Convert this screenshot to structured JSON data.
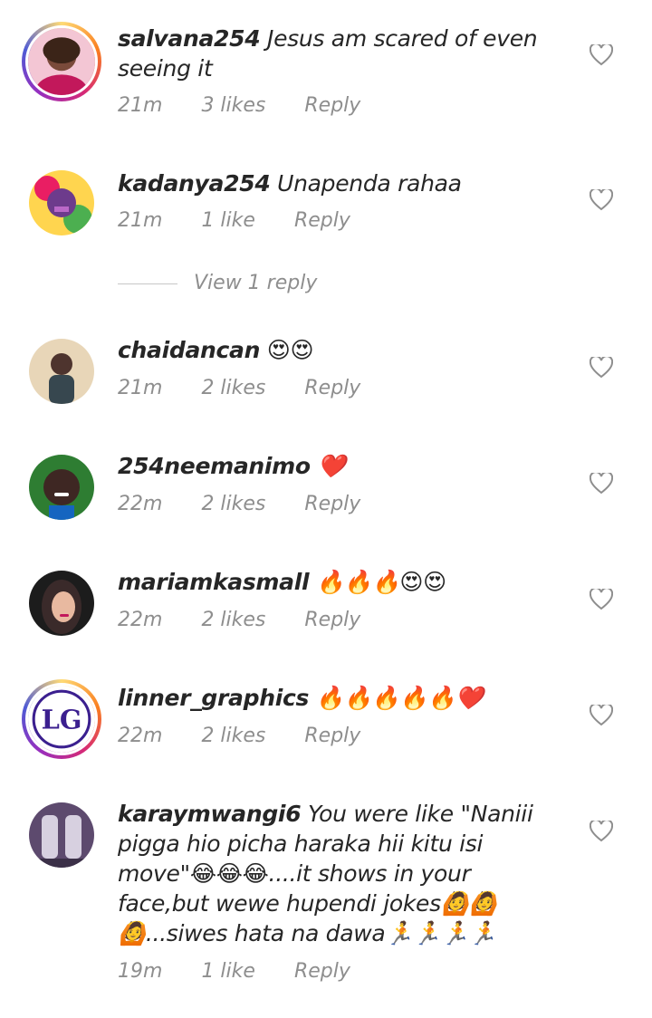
{
  "comments": [
    {
      "username": "salvana254",
      "text": "Jesus am scared of even seeing it",
      "time": "21m",
      "likes": "3 likes",
      "reply": "Reply",
      "avatar": "woman-avatar",
      "ring": true
    },
    {
      "username": "kadanya254",
      "text": "Unapenda rahaa",
      "time": "21m",
      "likes": "1 like",
      "reply": "Reply",
      "avatar": "colorful-avatar",
      "ring": false
    },
    {
      "username": "chaidancan",
      "text": "😍😍",
      "time": "21m",
      "likes": "2 likes",
      "reply": "Reply",
      "avatar": "person-avatar",
      "ring": false
    },
    {
      "username": "254neemanimo",
      "text": "❤️",
      "time": "22m",
      "likes": "2 likes",
      "reply": "Reply",
      "avatar": "smiling-avatar",
      "ring": false
    },
    {
      "username": "mariamkasmall",
      "text": "🔥🔥🔥😍😍",
      "time": "22m",
      "likes": "2 likes",
      "reply": "Reply",
      "avatar": "hijab-avatar",
      "ring": false
    },
    {
      "username": "linner_graphics",
      "text": "🔥🔥🔥🔥🔥❤️",
      "time": "22m",
      "likes": "2 likes",
      "reply": "Reply",
      "avatar": "logo-avatar",
      "ring": true,
      "logo_text": "LG"
    },
    {
      "username": "karaymwangi6",
      "text": "You were like \"Naniii pigga hio picha haraka hii kitu isi move\"😂😂😂....it shows in your face,but wewe hupendi jokes🙆🙆🙆...siwes hata na dawa🏃🏃🏃🏃",
      "time": "19m",
      "likes": "1 like",
      "reply": "Reply",
      "avatar": "glasses-avatar",
      "ring": false
    }
  ],
  "view_replies": "View 1 reply",
  "colors": {
    "text": "#262626",
    "meta": "#8e8e8e",
    "heart_outline": "#8e8e8e"
  }
}
